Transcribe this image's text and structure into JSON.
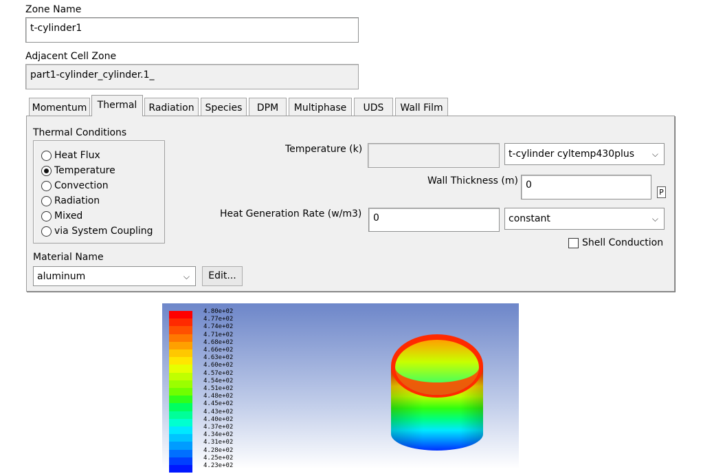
{
  "zone": {
    "name_label": "Zone Name",
    "name_value": "t-cylinder1",
    "adjacent_label": "Adjacent Cell Zone",
    "adjacent_value": "part1-cylinder_cylinder.1_"
  },
  "tabs": [
    {
      "label": "Momentum",
      "active": false
    },
    {
      "label": "Thermal",
      "active": true
    },
    {
      "label": "Radiation",
      "active": false
    },
    {
      "label": "Species",
      "active": false
    },
    {
      "label": "DPM",
      "active": false
    },
    {
      "label": "Multiphase",
      "active": false
    },
    {
      "label": "UDS",
      "active": false
    },
    {
      "label": "Wall Film",
      "active": false
    }
  ],
  "thermal": {
    "conditions_label": "Thermal Conditions",
    "conditions": [
      {
        "label": "Heat Flux",
        "selected": false
      },
      {
        "label": "Temperature",
        "selected": true
      },
      {
        "label": "Convection",
        "selected": false
      },
      {
        "label": "Radiation",
        "selected": false
      },
      {
        "label": "Mixed",
        "selected": false
      },
      {
        "label": "via System Coupling",
        "selected": false
      }
    ],
    "temperature_label": "Temperature (k)",
    "temperature_value": "",
    "temperature_profile": "t-cylinder cyltemp430plus",
    "wall_thickness_label": "Wall Thickness (m)",
    "wall_thickness_value": "0",
    "parameter_button": "P",
    "heat_gen_label": "Heat Generation Rate (w/m3)",
    "heat_gen_value": "0",
    "heat_gen_method": "constant",
    "shell_conduction_label": "Shell Conduction",
    "shell_conduction_checked": false,
    "material_label": "Material Name",
    "material_value": "aluminum",
    "edit_button": "Edit..."
  },
  "legend": {
    "labels": [
      "4.80e+02",
      "4.77e+02",
      "4.74e+02",
      "4.71e+02",
      "4.68e+02",
      "4.66e+02",
      "4.63e+02",
      "4.60e+02",
      "4.57e+02",
      "4.54e+02",
      "4.51e+02",
      "4.48e+02",
      "4.45e+02",
      "4.43e+02",
      "4.40e+02",
      "4.37e+02",
      "4.34e+02",
      "4.31e+02",
      "4.28e+02",
      "4.25e+02",
      "4.23e+02"
    ],
    "colors": [
      "#ff0000",
      "#ff2a00",
      "#ff5000",
      "#ff7800",
      "#ffa000",
      "#ffc800",
      "#ffe600",
      "#e6ff00",
      "#c0ff00",
      "#9aff00",
      "#70ff00",
      "#2fff1a",
      "#00ff60",
      "#00ff99",
      "#00ffd0",
      "#00e8ff",
      "#00c4ff",
      "#009cff",
      "#0070ff",
      "#0040ff",
      "#0018ff"
    ]
  }
}
